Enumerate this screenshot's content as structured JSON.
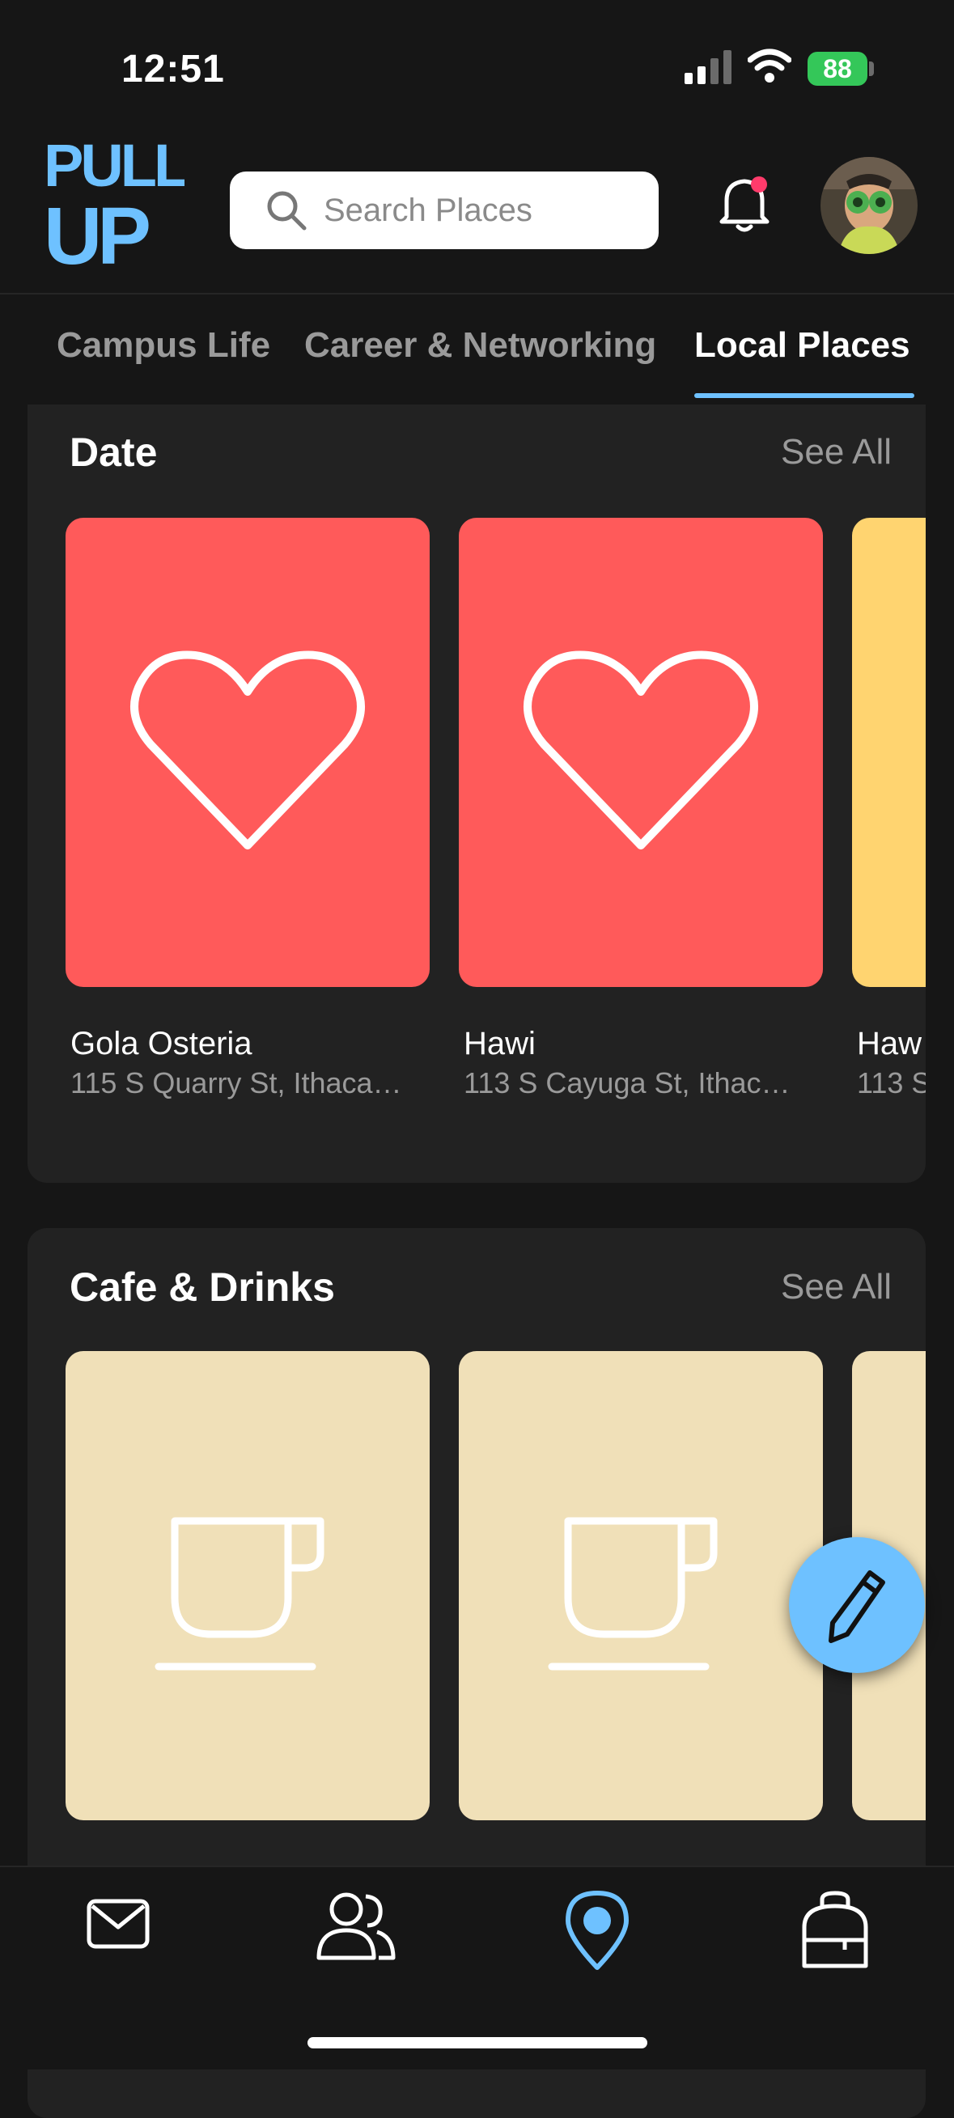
{
  "status_bar": {
    "time": "12:51",
    "battery": "88"
  },
  "header": {
    "logo_text": "PULL UP",
    "search_placeholder": "Search Places"
  },
  "tabs": [
    {
      "label": "Campus Life",
      "active": false
    },
    {
      "label": "Career & Networking",
      "active": false
    },
    {
      "label": "Local Places",
      "active": true
    }
  ],
  "sections": [
    {
      "title": "Date",
      "see_all": "See All",
      "cards": [
        {
          "name": "Gola Osteria",
          "address": "115 S Quarry St, Ithaca…",
          "icon": "heart-icon",
          "color": "#ff5a5a"
        },
        {
          "name": "Hawi",
          "address": "113 S Cayuga St, Ithac…",
          "icon": "heart-icon",
          "color": "#ff5a5a"
        },
        {
          "name": "Haw",
          "address": "113 S",
          "icon": "",
          "color": "#ffd470"
        }
      ]
    },
    {
      "title": "Cafe & Drinks",
      "see_all": "See All",
      "cards": [
        {
          "name": "",
          "address": "",
          "icon": "coffee-cup-icon",
          "color": "#f0e0b8"
        },
        {
          "name": "",
          "address": "",
          "icon": "coffee-cup-icon",
          "color": "#f0e0b8"
        },
        {
          "name": "",
          "address": "",
          "icon": "",
          "color": "#f0e0b8"
        }
      ]
    }
  ],
  "bottom_nav": [
    {
      "icon": "mail-icon",
      "active": false
    },
    {
      "icon": "people-icon",
      "active": false
    },
    {
      "icon": "location-pin-icon",
      "active": true
    },
    {
      "icon": "backpack-icon",
      "active": false
    }
  ],
  "colors": {
    "accent": "#6ec1ff",
    "date_card": "#ff5a5a",
    "cafe_card": "#f0e0b8",
    "notification_dot": "#ff3b6b"
  }
}
